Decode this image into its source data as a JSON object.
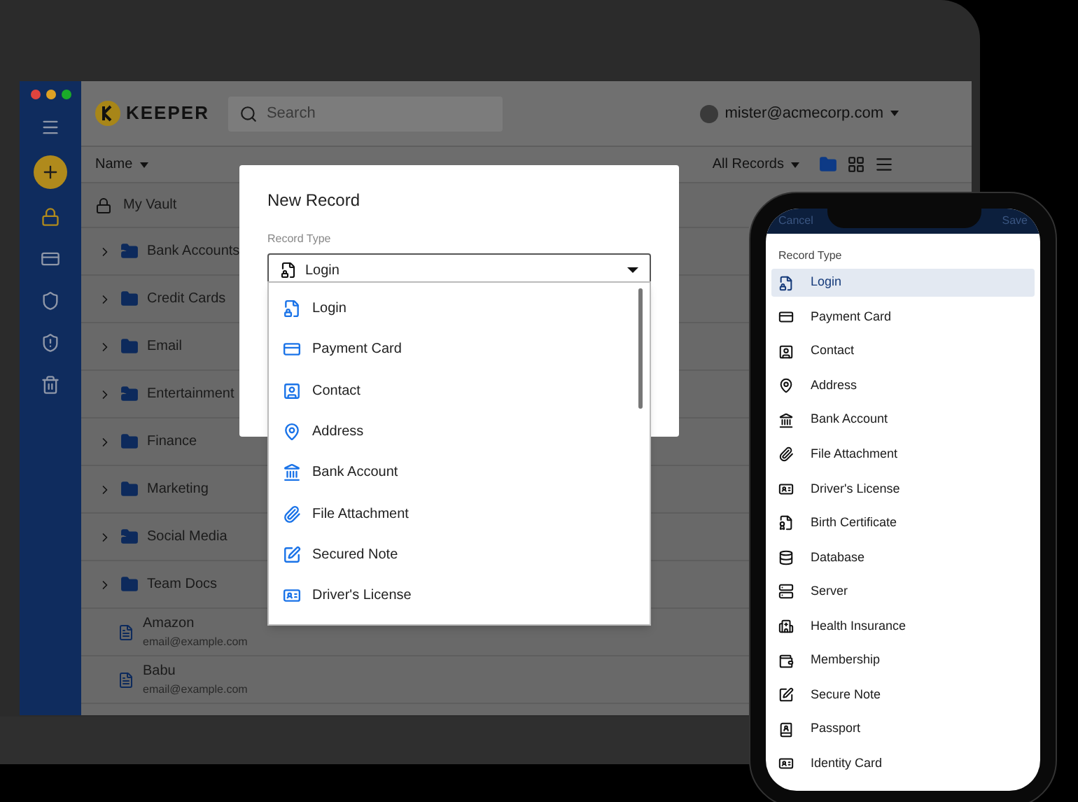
{
  "window_buttons": [
    {
      "color": "#e0443e"
    },
    {
      "color": "#dea123"
    },
    {
      "color": "#1aab29"
    }
  ],
  "sidebar": {
    "items": [
      {
        "kind": "menu"
      },
      {
        "kind": "add"
      },
      {
        "kind": "vault",
        "selected": true
      },
      {
        "kind": "card",
        "selected": false
      },
      {
        "kind": "shield",
        "selected": false
      },
      {
        "kind": "breach",
        "selected": false
      },
      {
        "kind": "trash",
        "selected": false
      }
    ]
  },
  "header": {
    "logo": "KEEPER",
    "search": {
      "placeholder": "Search"
    },
    "account": "mister@acmecorp.com"
  },
  "toolbar": {
    "sort": "Name",
    "filter": "All Records",
    "views": [
      {
        "kind": "folder",
        "selected": true
      },
      {
        "kind": "grid",
        "selected": false
      },
      {
        "kind": "list",
        "selected": false
      }
    ]
  },
  "vault": {
    "title": "My Vault",
    "items": [
      {
        "kind": "shared_folder",
        "name": "Bank Accounts"
      },
      {
        "kind": "folder",
        "name": "Credit Cards"
      },
      {
        "kind": "folder",
        "name": "Email"
      },
      {
        "kind": "shared_folder",
        "name": "Entertainment"
      },
      {
        "kind": "folder",
        "name": "Finance"
      },
      {
        "kind": "folder",
        "name": "Marketing"
      },
      {
        "kind": "shared_folder",
        "name": "Social Media"
      },
      {
        "kind": "folder",
        "name": "Team Docs"
      },
      {
        "kind": "record",
        "name": "Amazon",
        "subtitle": "email@example.com"
      },
      {
        "kind": "record",
        "name": "Babu",
        "subtitle": "email@example.com"
      }
    ]
  },
  "dialog": {
    "title": "New Record",
    "field_label": "Record Type",
    "value": {
      "kind": "login",
      "label": "Login"
    },
    "options": [
      {
        "kind": "login",
        "label": "Login"
      },
      {
        "kind": "card",
        "label": "Payment Card"
      },
      {
        "kind": "contact",
        "label": "Contact"
      },
      {
        "kind": "address",
        "label": "Address"
      },
      {
        "kind": "bank",
        "label": "Bank Account"
      },
      {
        "kind": "file",
        "label": "File Attachment"
      },
      {
        "kind": "note",
        "label": "Secured Note"
      },
      {
        "kind": "license",
        "label": "Driver's License"
      }
    ]
  },
  "mobile": {
    "cancel": "Cancel",
    "save": "Save",
    "label": "Record Type",
    "options": [
      {
        "kind": "login",
        "label": "Login",
        "selected": true
      },
      {
        "kind": "card",
        "label": "Payment Card",
        "selected": false
      },
      {
        "kind": "contact",
        "label": "Contact",
        "selected": false
      },
      {
        "kind": "address",
        "label": "Address",
        "selected": false
      },
      {
        "kind": "bank",
        "label": "Bank Account",
        "selected": false
      },
      {
        "kind": "file",
        "label": "File Attachment",
        "selected": false
      },
      {
        "kind": "license",
        "label": "Driver's License",
        "selected": false
      },
      {
        "kind": "birth",
        "label": "Birth Certificate",
        "selected": false
      },
      {
        "kind": "database",
        "label": "Database",
        "selected": false
      },
      {
        "kind": "server",
        "label": "Server",
        "selected": false
      },
      {
        "kind": "health",
        "label": "Health Insurance",
        "selected": false
      },
      {
        "kind": "membership",
        "label": "Membership",
        "selected": false
      },
      {
        "kind": "note",
        "label": "Secure Note",
        "selected": false
      },
      {
        "kind": "passport",
        "label": "Passport",
        "selected": false
      },
      {
        "kind": "idcard",
        "label": "Identity Card",
        "selected": false
      }
    ]
  }
}
